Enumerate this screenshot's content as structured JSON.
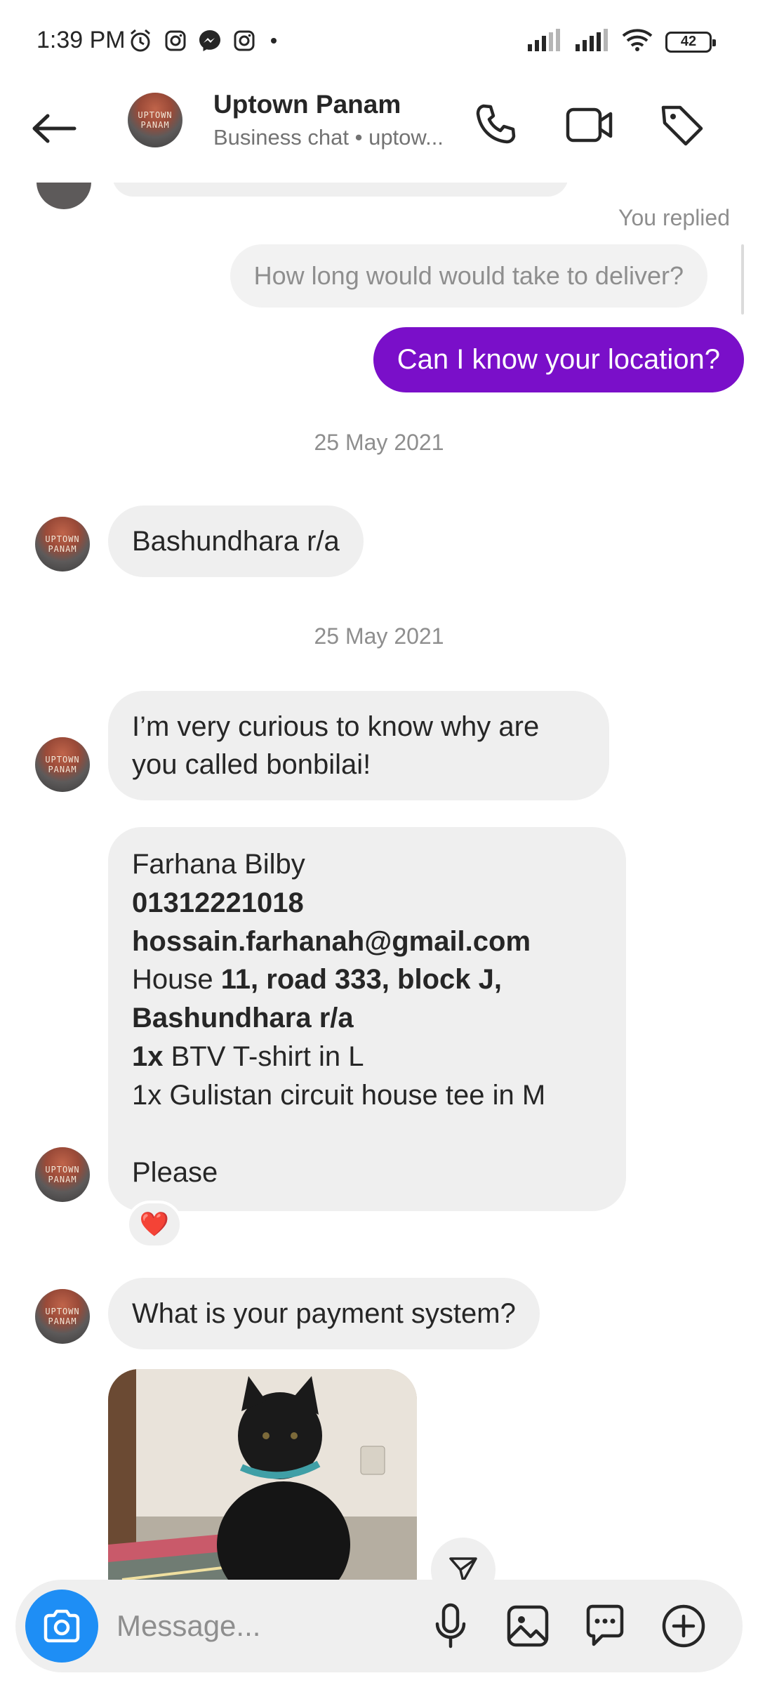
{
  "status_bar": {
    "time": "1:39 PM",
    "battery": "42",
    "left_icons": [
      "alarm-icon",
      "instagram-icon",
      "messenger-icon",
      "instagram-icon",
      "dot-icon"
    ],
    "right_icons": [
      "signal-icon",
      "signal-icon",
      "wifi-icon",
      "battery-icon"
    ]
  },
  "header": {
    "name": "Uptown Panam",
    "subtitle": "Business chat • uptow...",
    "avatar_text_top": "UPTOWN",
    "avatar_text_bottom": "PANAM",
    "icons": [
      "back-arrow-icon",
      "phone-icon",
      "video-icon",
      "tag-icon"
    ]
  },
  "conversation": {
    "you_replied_label": "You replied",
    "replied_quote": "How long would would take to deliver?",
    "sent_message": "Can I know your location?",
    "date_1": "25 May 2021",
    "msg_location": "Bashundhara r/a",
    "date_2": "25 May 2021",
    "msg_curious_line1": "I’m very curious to know why are",
    "msg_curious_line2": "you called bonbilai!",
    "order": {
      "name": "Farhana Bilby",
      "phone": "01312221018",
      "email": "hossain.farhanah@gmail.com",
      "house_prefix": "House ",
      "house_bold": "11, road 333, block J,",
      "area": "Bashundhara r/a",
      "item1_qty": "1x",
      "item1_desc": " BTV T-shirt in L",
      "item2": "1x Gulistan circuit house tee in M",
      "closing": "Please"
    },
    "reaction": "❤️",
    "msg_payment": "What is your payment system?"
  },
  "composer": {
    "placeholder": "Message...",
    "icons": [
      "camera-icon",
      "microphone-icon",
      "gallery-icon",
      "sticker-icon",
      "plus-icon"
    ]
  },
  "colors": {
    "sent_bubble": "#7a0fc9",
    "received_bubble": "#efefef",
    "camera_button": "#1e8ef5"
  }
}
